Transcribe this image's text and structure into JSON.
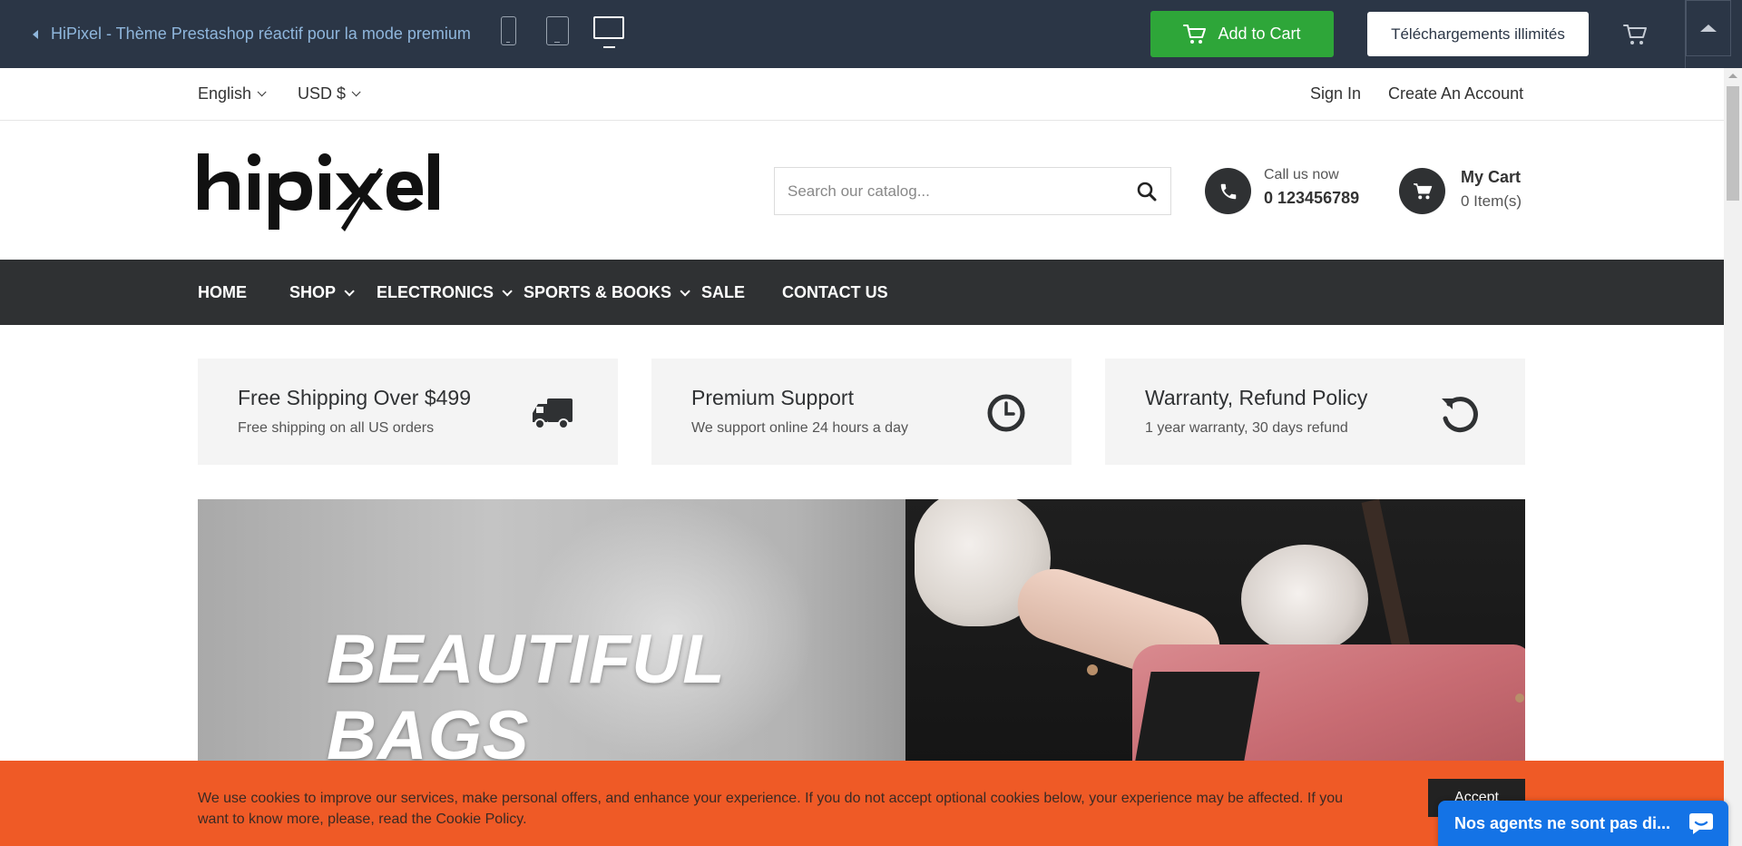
{
  "demo_bar": {
    "back_label": "HiPixel - Thème Prestashop réactif pour la mode premium",
    "add_to_cart_label": "Add to Cart",
    "downloads_label": "Téléchargements illimités"
  },
  "topnav": {
    "language": "English",
    "currency": "USD $",
    "sign_in": "Sign In",
    "create_account": "Create An Account"
  },
  "header": {
    "search_placeholder": "Search our catalog...",
    "call_label": "Call us now",
    "call_number": "0 123456789",
    "cart_title": "My Cart",
    "cart_count": "0 Item(s)"
  },
  "menu": {
    "items": [
      {
        "label": "HOME"
      },
      {
        "label": "SHOP"
      },
      {
        "label": "ELECTRONICS"
      },
      {
        "label": "SPORTS & BOOKS"
      },
      {
        "label": "SALE"
      },
      {
        "label": "CONTACT US"
      }
    ]
  },
  "services": [
    {
      "title": "Free Shipping Over $499",
      "subtitle": "Free shipping on all US orders",
      "icon": "truck-icon"
    },
    {
      "title": "Premium Support",
      "subtitle": "We support online 24 hours a day",
      "icon": "clock-icon"
    },
    {
      "title": "Warranty, Refund Policy",
      "subtitle": "1 year warranty, 30 days refund",
      "icon": "refresh-icon"
    }
  ],
  "banner": {
    "headline_line1": "BEAUTIFUL",
    "headline_line2": "BAGS"
  },
  "cookie": {
    "text": "We use cookies to improve our services, make personal offers, and enhance your experience. If you do not accept optional cookies below, your experience may be affected. If you want to know more, please, read the Cookie Policy.",
    "accept_label": "Accept"
  },
  "chat": {
    "label": "Nos agents ne sont pas di..."
  },
  "colors": {
    "demo_bar_bg": "#2b3646",
    "add_to_cart_green": "#2ea639",
    "menu_bg": "#2f3133",
    "cookie_orange": "#ef5a26",
    "chat_blue": "#1473e6"
  }
}
